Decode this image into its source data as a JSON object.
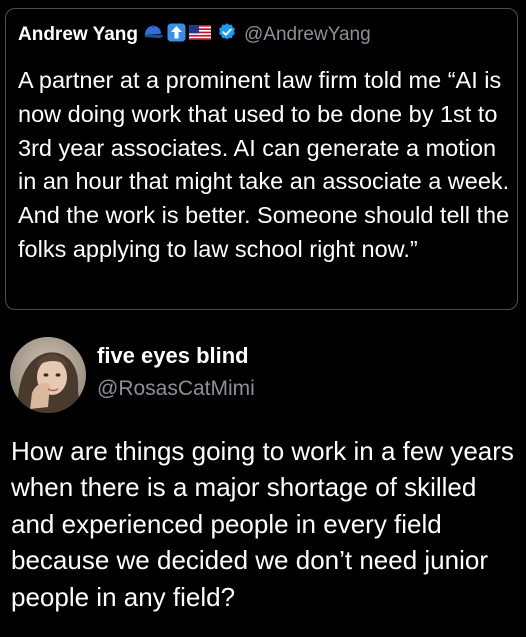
{
  "quoted_tweet": {
    "author_name": "Andrew Yang",
    "author_handle": "@AndrewYang",
    "name_emojis": [
      "blue-cap-icon",
      "up-arrow-icon",
      "us-flag-icon"
    ],
    "verified": true,
    "text": "A partner at a prominent law firm told me “AI is now doing work that used to be done by 1st to 3rd year associates.  AI can generate a motion in an hour that might take an associate a week.  And the work is better.  Someone should tell the folks applying to law school right now.”"
  },
  "reply": {
    "author_name": "five eyes blind",
    "author_handle": "@RosasCatMimi",
    "text": "How are things going to work in a few years when there is a major shortage of skilled and experienced people in every field because we decided we don’t need junior people in any field?"
  },
  "colors": {
    "background": "#000000",
    "text": "#ffffff",
    "secondary_text": "#8b9096",
    "border": "#4a4d52",
    "verified_badge": "#1d9bf0"
  }
}
